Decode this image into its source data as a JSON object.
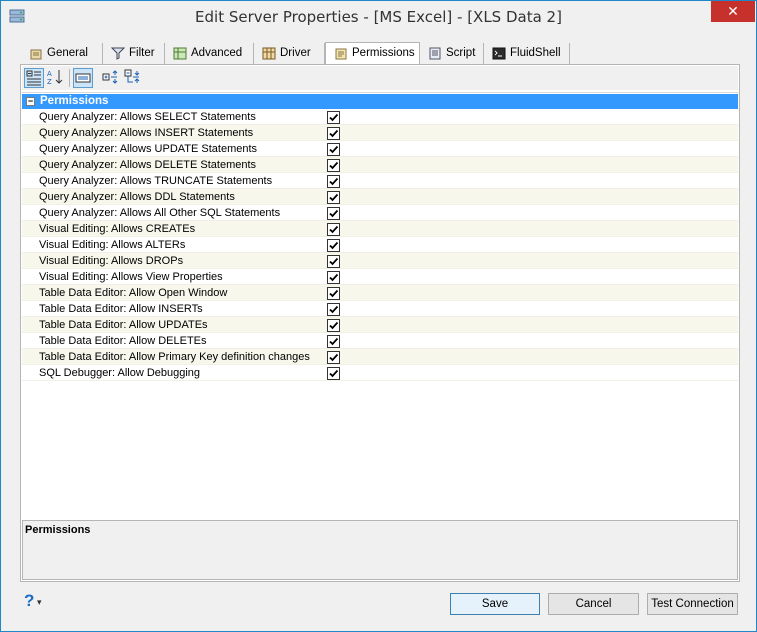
{
  "window": {
    "title": "Edit Server Properties - [MS Excel] - [XLS Data 2]",
    "close_label": "✕"
  },
  "tabs": [
    {
      "label": "General",
      "icon": "general-icon"
    },
    {
      "label": "Filter",
      "icon": "filter-icon"
    },
    {
      "label": "Advanced",
      "icon": "advanced-icon"
    },
    {
      "label": "Driver",
      "icon": "driver-icon"
    },
    {
      "label": "Permissions",
      "icon": "permissions-icon",
      "active": true
    },
    {
      "label": "Script",
      "icon": "script-icon"
    },
    {
      "label": "FluidShell",
      "icon": "fluidshell-icon"
    }
  ],
  "category": {
    "label": "Permissions",
    "toggle": "−"
  },
  "properties": [
    {
      "name": "Query Analyzer: Allows SELECT Statements",
      "checked": true
    },
    {
      "name": "Query Analyzer: Allows INSERT Statements",
      "checked": true
    },
    {
      "name": "Query Analyzer: Allows UPDATE Statements",
      "checked": true
    },
    {
      "name": "Query Analyzer: Allows DELETE Statements",
      "checked": true
    },
    {
      "name": "Query Analyzer: Allows TRUNCATE Statements",
      "checked": true
    },
    {
      "name": "Query Analyzer: Allows DDL Statements",
      "checked": true
    },
    {
      "name": "Query Analyzer: Allows All Other SQL Statements",
      "checked": true
    },
    {
      "name": "Visual Editing: Allows CREATEs",
      "checked": true
    },
    {
      "name": "Visual Editing: Allows ALTERs",
      "checked": true
    },
    {
      "name": "Visual Editing: Allows DROPs",
      "checked": true
    },
    {
      "name": "Visual Editing: Allows View Properties",
      "checked": true
    },
    {
      "name": "Table Data Editor: Allow Open Window",
      "checked": true
    },
    {
      "name": "Table Data Editor: Allow INSERTs",
      "checked": true
    },
    {
      "name": "Table Data Editor: Allow UPDATEs",
      "checked": true
    },
    {
      "name": "Table Data Editor: Allow DELETEs",
      "checked": true
    },
    {
      "name": "Table Data Editor: Allow Primary Key definition changes",
      "checked": true
    },
    {
      "name": "SQL Debugger: Allow Debugging",
      "checked": true
    }
  ],
  "description": {
    "title": "Permissions"
  },
  "help": {
    "label": "?",
    "arrow": "▾"
  },
  "buttons": {
    "save": "Save",
    "cancel": "Cancel",
    "test": "Test Connection"
  },
  "colors": {
    "accent": "#3399ff",
    "alt_row": "#f7f7ec",
    "close": "#c7312b"
  }
}
